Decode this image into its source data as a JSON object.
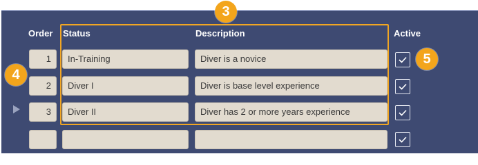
{
  "columns": {
    "order": "Order",
    "status": "Status",
    "description": "Description",
    "active": "Active"
  },
  "rows": [
    {
      "order": "1",
      "status": "In-Training",
      "description": "Diver is a novice",
      "active": true
    },
    {
      "order": "2",
      "status": "Diver I",
      "description": "Diver is base level experience",
      "active": true
    },
    {
      "order": "3",
      "status": "Diver II",
      "description": "Diver has 2 or more years experience",
      "active": true
    },
    {
      "order": "",
      "status": "",
      "description": "",
      "active": true
    }
  ],
  "callouts": {
    "three": "3",
    "four": "4",
    "five": "5"
  },
  "current_row_indicator": "row-3",
  "colors": {
    "panel": "#3e4a72",
    "field": "#e2dbcf",
    "callout": "#f3a51c",
    "highlight": "#f1a623"
  }
}
